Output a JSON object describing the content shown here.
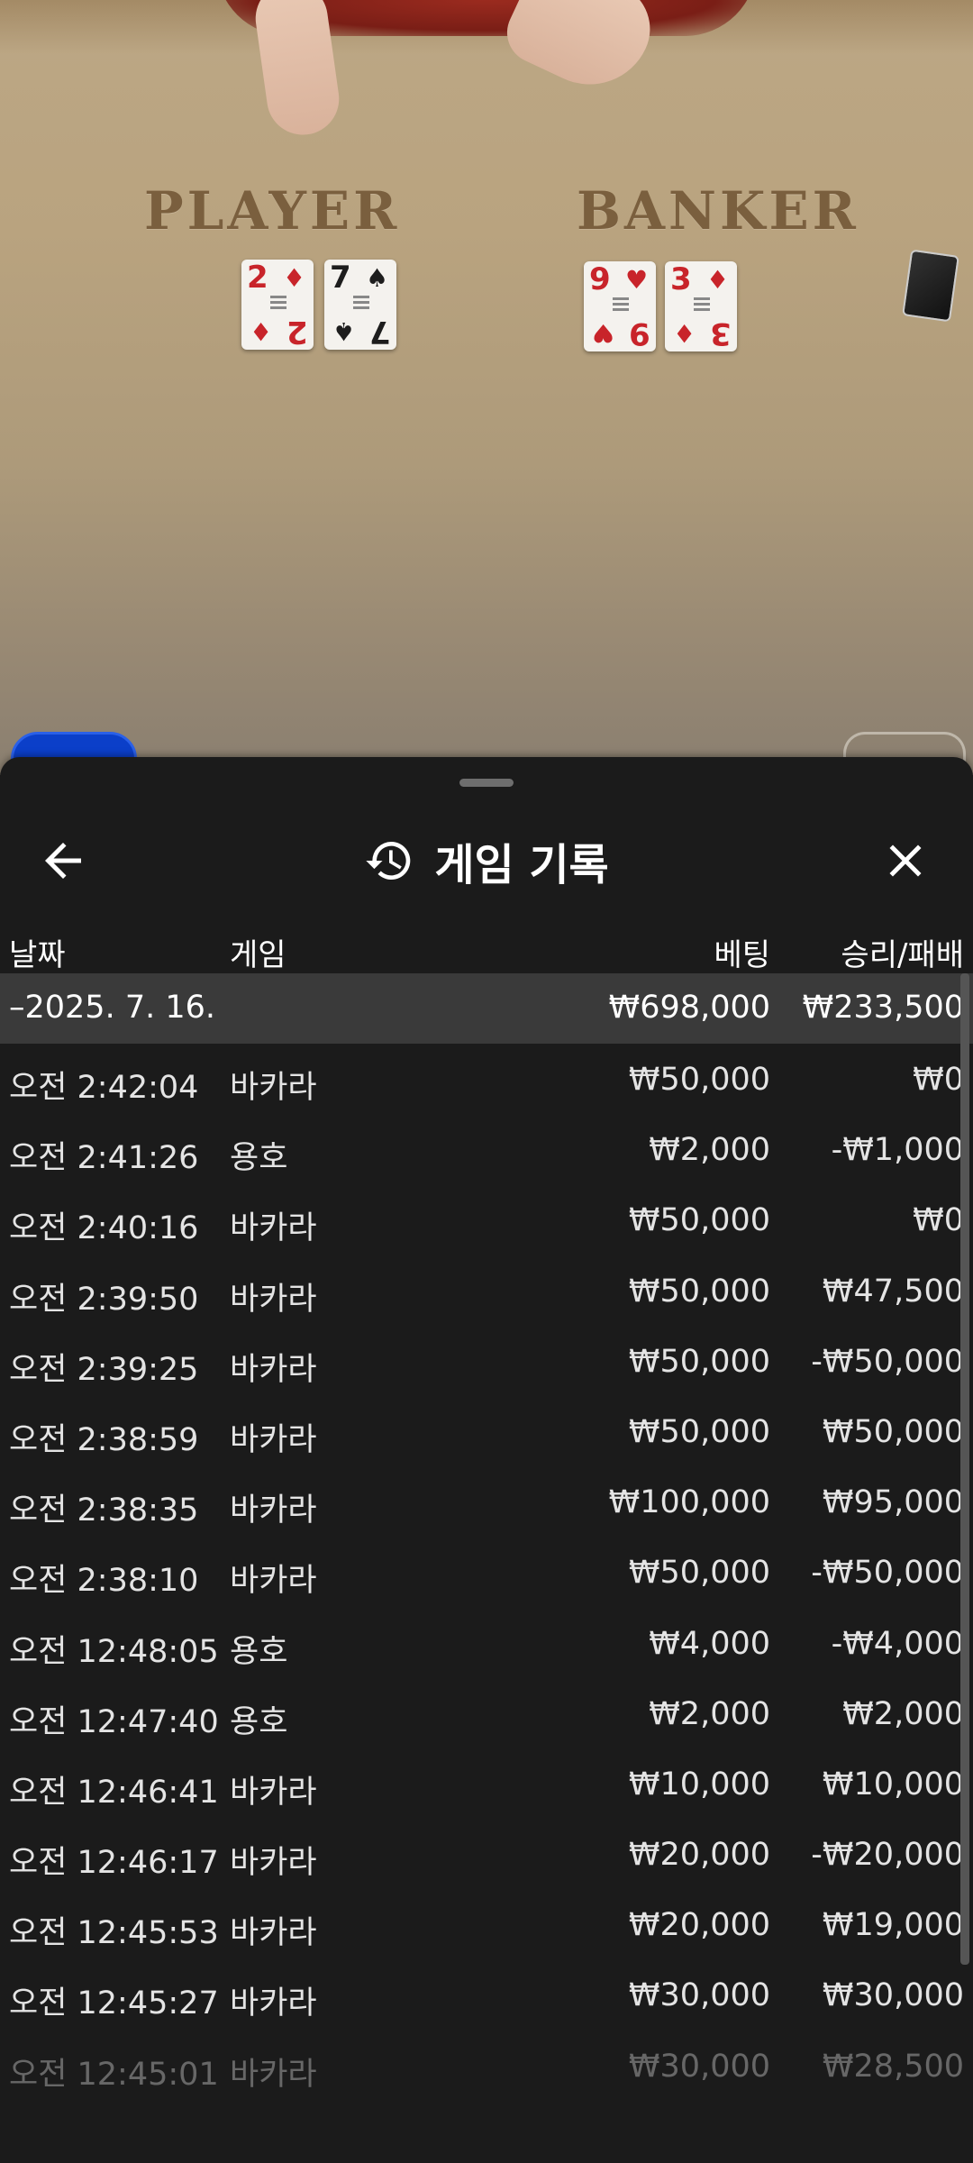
{
  "table": {
    "player_label": "PLAYER",
    "banker_label": "BANKER",
    "player_cards": [
      {
        "rank": "2",
        "suit": "♦",
        "color": "red"
      },
      {
        "rank": "7",
        "suit": "♠",
        "color": "black"
      }
    ],
    "banker_cards": [
      {
        "rank": "9",
        "suit": "♥",
        "color": "red"
      },
      {
        "rank": "3",
        "suit": "♦",
        "color": "red"
      }
    ]
  },
  "sheet": {
    "title": "게임 기록",
    "icons": {
      "back": "arrow-left-icon",
      "history": "history-icon",
      "close": "close-icon"
    },
    "columns": {
      "date": "날짜",
      "game": "게임",
      "bet": "베팅",
      "win_loss": "승리/패배"
    },
    "date_group": {
      "date": "–2025. 7. 16.",
      "bet": "₩698,000",
      "win_loss": "₩233,500"
    },
    "rows": [
      {
        "time": "오전 2:42:04",
        "game": "바카라",
        "bet": "₩50,000",
        "win_loss": "₩0"
      },
      {
        "time": "오전 2:41:26",
        "game": "용호",
        "bet": "₩2,000",
        "win_loss": "-₩1,000"
      },
      {
        "time": "오전 2:40:16",
        "game": "바카라",
        "bet": "₩50,000",
        "win_loss": "₩0"
      },
      {
        "time": "오전 2:39:50",
        "game": "바카라",
        "bet": "₩50,000",
        "win_loss": "₩47,500"
      },
      {
        "time": "오전 2:39:25",
        "game": "바카라",
        "bet": "₩50,000",
        "win_loss": "-₩50,000"
      },
      {
        "time": "오전 2:38:59",
        "game": "바카라",
        "bet": "₩50,000",
        "win_loss": "₩50,000"
      },
      {
        "time": "오전 2:38:35",
        "game": "바카라",
        "bet": "₩100,000",
        "win_loss": "₩95,000"
      },
      {
        "time": "오전 2:38:10",
        "game": "바카라",
        "bet": "₩50,000",
        "win_loss": "-₩50,000"
      },
      {
        "time": "오전 12:48:05",
        "game": "용호",
        "bet": "₩4,000",
        "win_loss": "-₩4,000"
      },
      {
        "time": "오전 12:47:40",
        "game": "용호",
        "bet": "₩2,000",
        "win_loss": "₩2,000"
      },
      {
        "time": "오전 12:46:41",
        "game": "바카라",
        "bet": "₩10,000",
        "win_loss": "₩10,000"
      },
      {
        "time": "오전 12:46:17",
        "game": "바카라",
        "bet": "₩20,000",
        "win_loss": "-₩20,000"
      },
      {
        "time": "오전 12:45:53",
        "game": "바카라",
        "bet": "₩20,000",
        "win_loss": "₩19,000"
      },
      {
        "time": "오전 12:45:27",
        "game": "바카라",
        "bet": "₩30,000",
        "win_loss": "₩30,000"
      },
      {
        "time": "오전 12:45:01",
        "game": "바카라",
        "bet": "₩30,000",
        "win_loss": "₩28,500"
      }
    ]
  }
}
